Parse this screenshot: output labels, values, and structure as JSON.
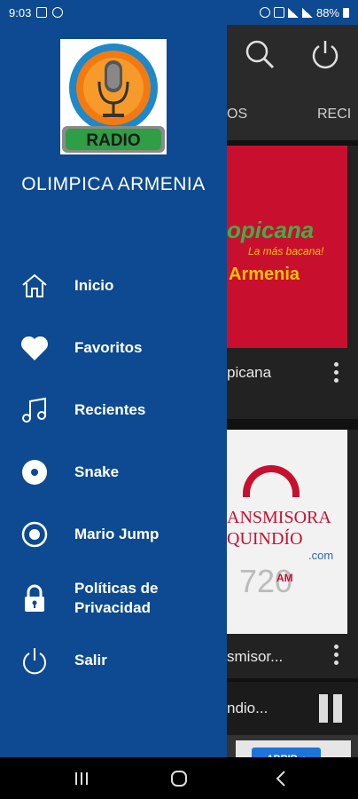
{
  "status_bar": {
    "time": "9:03",
    "battery": "88%"
  },
  "app": {
    "tabs": [
      "OS",
      "RECI"
    ],
    "cards": [
      {
        "logo_text": "opicana",
        "logo_sub": "La más bacana!",
        "logo_city": "Armenia",
        "title": "picana"
      },
      {
        "logo_line1": "ANSMISORA",
        "logo_line2": "QUINDÍO",
        "logo_domain": ".com",
        "logo_freq": "720",
        "logo_band": "AM",
        "title": "smisor..."
      }
    ],
    "mini_player": {
      "title": "ndio..."
    },
    "ad": {
      "button_label": "ABRIR"
    }
  },
  "drawer": {
    "logo_text": "RADIO",
    "title": "OLIMPICA ARMENIA",
    "menu": [
      {
        "label": "Inicio",
        "icon": "home-icon"
      },
      {
        "label": "Favoritos",
        "icon": "heart-icon"
      },
      {
        "label": "Recientes",
        "icon": "music-note-icon"
      },
      {
        "label": "Snake",
        "icon": "disc-icon"
      },
      {
        "label": "Mario Jump",
        "icon": "target-icon"
      },
      {
        "label": "Políticas de Privacidad",
        "icon": "lock-icon"
      },
      {
        "label": "Salir",
        "icon": "power-icon"
      }
    ]
  },
  "colors": {
    "drawer_bg": "#0d4a91",
    "accent_red": "#c8102e",
    "ad_button": "#1e73d8"
  }
}
